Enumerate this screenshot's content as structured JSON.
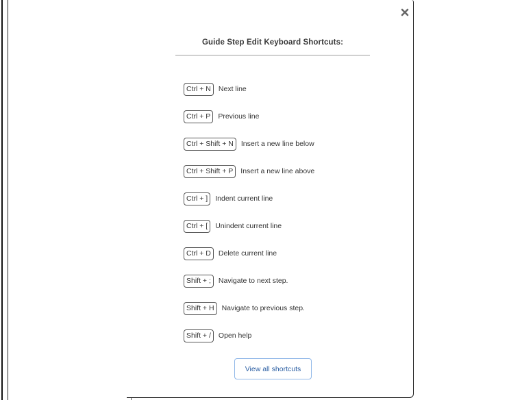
{
  "dialog": {
    "title": "Guide Step Edit Keyboard Shortcuts:",
    "close_icon": "close-icon"
  },
  "shortcuts": [
    {
      "keys": "Ctrl + N",
      "description": "Next line"
    },
    {
      "keys": "Ctrl + P",
      "description": "Previous line"
    },
    {
      "keys": "Ctrl + Shift + N",
      "description": "Insert a new line below"
    },
    {
      "keys": "Ctrl + Shift + P",
      "description": "Insert a new line above"
    },
    {
      "keys": "Ctrl + ]",
      "description": "Indent current line"
    },
    {
      "keys": "Ctrl + [",
      "description": "Unindent current line"
    },
    {
      "keys": "Ctrl + D",
      "description": "Delete current line"
    },
    {
      "keys": "Shift + ;",
      "description": "Navigate to next step."
    },
    {
      "keys": "Shift + H",
      "description": "Navigate to previous step."
    },
    {
      "keys": "Shift + /",
      "description": "Open help"
    }
  ],
  "footer": {
    "view_all_label": "View all shortcuts"
  },
  "colors": {
    "button_border": "#8fb7e8",
    "button_text": "#2c5fa3",
    "text": "#333333",
    "frame": "#222222"
  }
}
